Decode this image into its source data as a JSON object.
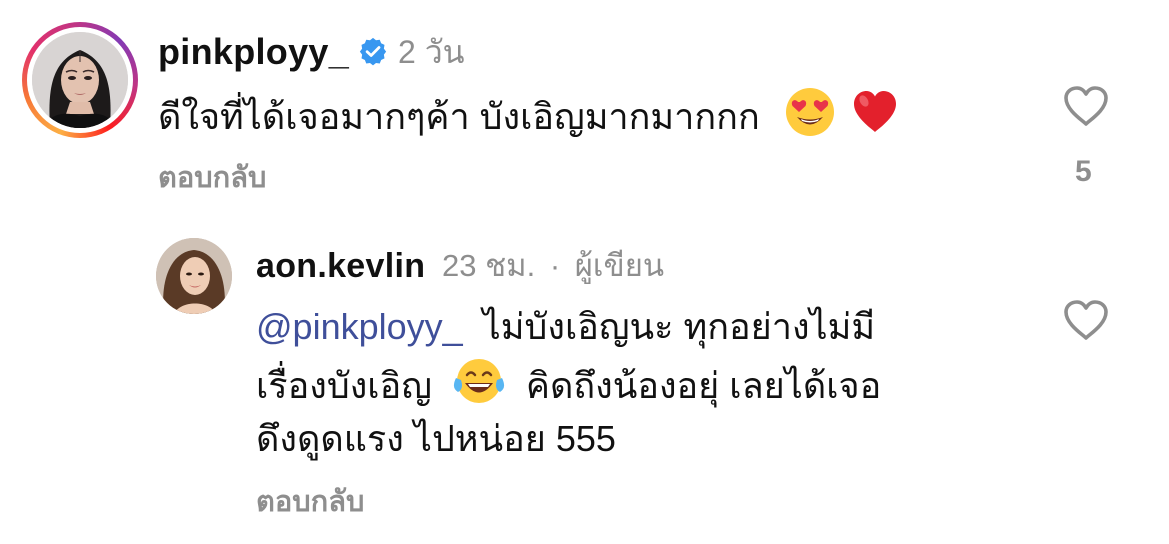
{
  "comment": {
    "username": "pinkployy_",
    "verified_icon": "verified-badge-icon",
    "time": "2 วัน",
    "text": "ดีใจที่ได้เจอมากๆค้า บังเอิญมากมากกก",
    "emojis": [
      "😍",
      "❤️"
    ],
    "reply_label": "ตอบกลับ",
    "like_icon": "heart-outline-icon",
    "like_count": "5"
  },
  "reply": {
    "username": "aon.kevlin",
    "time": "23 ชม.",
    "separator": "·",
    "author_tag": "ผู้เขียน",
    "mention": "@pinkployy_",
    "line1_text": "ไม่บังเอิญนะ ทุกอย่างไม่มี",
    "line2_text_a": "เรื่องบังเอิญ",
    "line2_emoji": "😂",
    "line2_text_b": "คิดถึงน้องอยุ่ เลยได้เจอ",
    "line3_text": "ดึงดูดแรง ไปหน่อย 555",
    "reply_label": "ตอบกลับ",
    "like_icon": "heart-outline-icon"
  },
  "colors": {
    "text": "#111111",
    "secondary": "#8e8e8e",
    "mention": "#3f4f9a",
    "verified": "#3897f0"
  }
}
